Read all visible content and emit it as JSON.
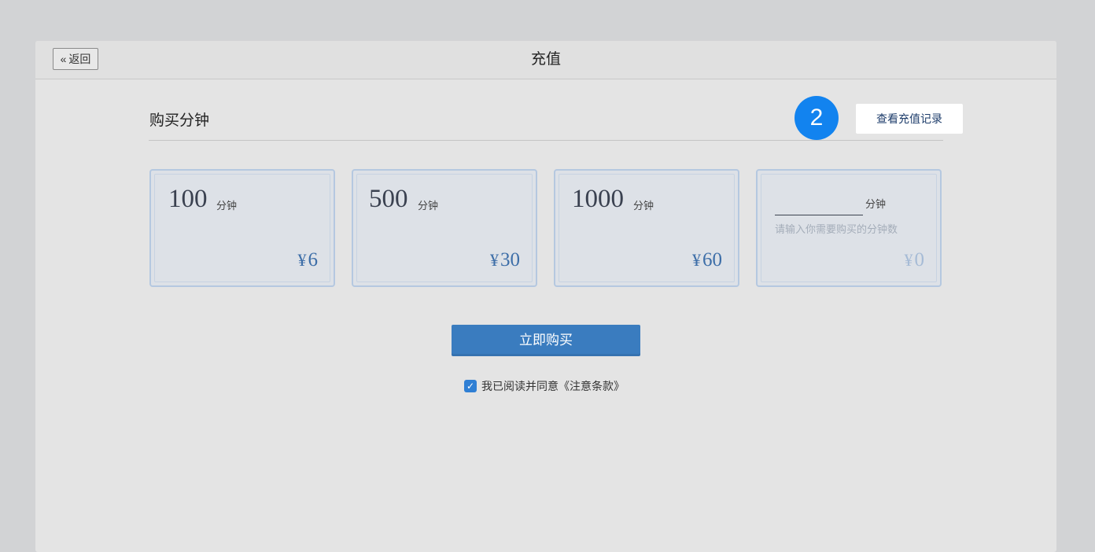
{
  "header": {
    "back_label": "返回",
    "title": "充值"
  },
  "section": {
    "title": "购买分钟",
    "badge": "2",
    "history_button": "查看充值记录"
  },
  "packages": [
    {
      "minutes": "100",
      "unit": "分钟",
      "price": "6"
    },
    {
      "minutes": "500",
      "unit": "分钟",
      "price": "30"
    },
    {
      "minutes": "1000",
      "unit": "分钟",
      "price": "60"
    }
  ],
  "custom_package": {
    "value": "",
    "unit": "分钟",
    "hint": "请输入你需要购买的分钟数",
    "price": "0"
  },
  "currency_symbol": "¥",
  "buy_button": "立即购买",
  "agreement": {
    "checked": true,
    "label": "我已阅读并同意《注意条款》"
  },
  "colors": {
    "badge": "#1283ef",
    "buy_button": "#3a7cbf",
    "price": "#3d6ea8",
    "card_border": "#b5c8e0"
  }
}
